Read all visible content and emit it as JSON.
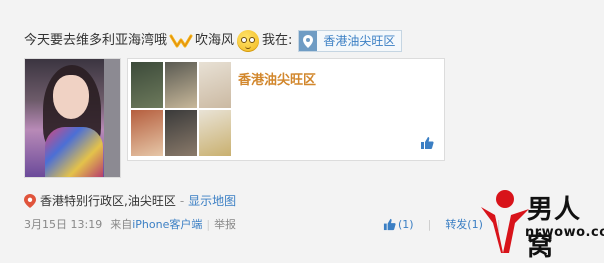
{
  "post": {
    "text_part1": "今天要去维多利亚海湾哦",
    "text_part2": "吹海风",
    "checkin_label": "我在:",
    "location_tag": "香港油尖旺区"
  },
  "place_card": {
    "title": "香港油尖旺区"
  },
  "location_line": {
    "address": "香港特别行政区,油尖旺区",
    "separator": "-",
    "show_map": "显示地图"
  },
  "meta": {
    "timestamp": "3月15日 13:19",
    "source_prefix": "来自",
    "source_app": "iPhone客户端",
    "separator": "|",
    "report": "举报"
  },
  "actions": {
    "like_count": "(1)",
    "separator": "|",
    "repost_label": "转发(1)",
    "separator2": "|"
  },
  "watermark": {
    "logo_text": "男人窝",
    "url": "nrwowo.com"
  },
  "colors": {
    "accent_link": "#3b7fc4",
    "card_title": "#d2872d",
    "pin_red": "#e0543c"
  }
}
